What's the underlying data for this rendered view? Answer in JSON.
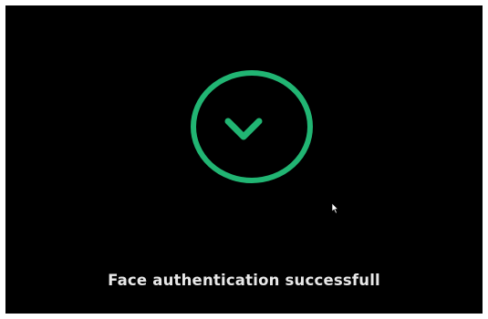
{
  "screen": {
    "status_message": "Face authentication successfull",
    "icon": "checkmark-circle-icon",
    "accent_color": "#21b573",
    "background_color": "#000000"
  },
  "cursor": {
    "icon": "mouse-pointer-icon"
  }
}
